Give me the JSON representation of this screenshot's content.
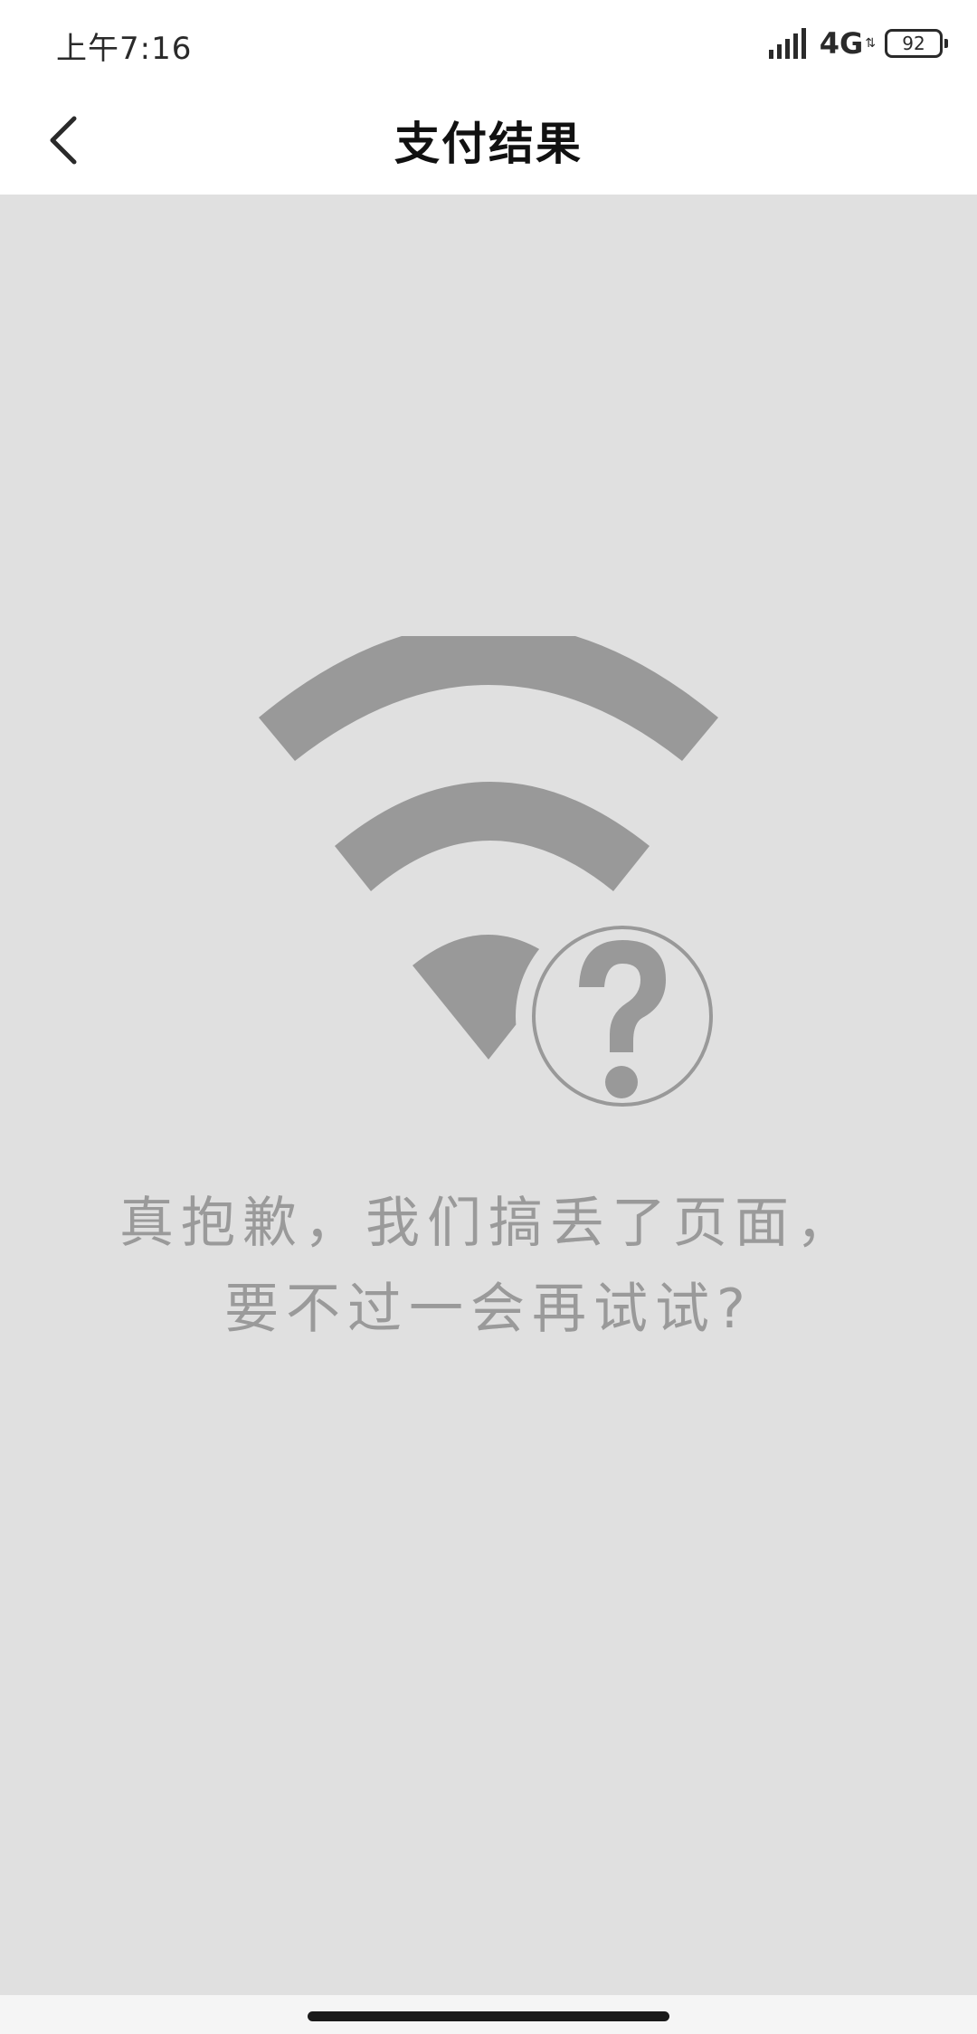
{
  "status_bar": {
    "time": "上午7:16",
    "network": "4G",
    "battery": "92"
  },
  "nav": {
    "title": "支付结果",
    "back_icon": "chevron-left-icon"
  },
  "error": {
    "icon": "wifi-question-icon",
    "message_line1": "真抱歉，我们搞丢了页面，",
    "message_line2": "要不过一会再试试?"
  },
  "colors": {
    "content_bg": "#e0e0e0",
    "illustration": "#999999",
    "message_text": "#9a9a9a"
  }
}
